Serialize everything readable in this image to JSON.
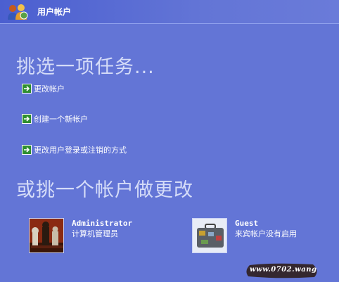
{
  "header": {
    "title": "用户帐户",
    "icon": "users-icon"
  },
  "tasks_heading": "挑选一项任务...",
  "tasks": [
    {
      "label": "更改帐户",
      "icon": "green-arrow-icon"
    },
    {
      "label": "创建一个新帐户",
      "icon": "green-arrow-icon"
    },
    {
      "label": "更改用户登录或注销的方式",
      "icon": "green-arrow-icon"
    }
  ],
  "accounts_heading": "或挑一个帐户做更改",
  "accounts": [
    {
      "name": "Administrator",
      "description": "计算机管理员",
      "icon": "chess-pieces-picture"
    },
    {
      "name": "Guest",
      "description": "来宾帐户没有启用",
      "icon": "briefcase-picture"
    }
  ],
  "watermark": "www.0702.wang",
  "colors": {
    "background": "#6375d6",
    "heading": "#d5dcf8",
    "arrow_green": "#2f8f2f"
  }
}
